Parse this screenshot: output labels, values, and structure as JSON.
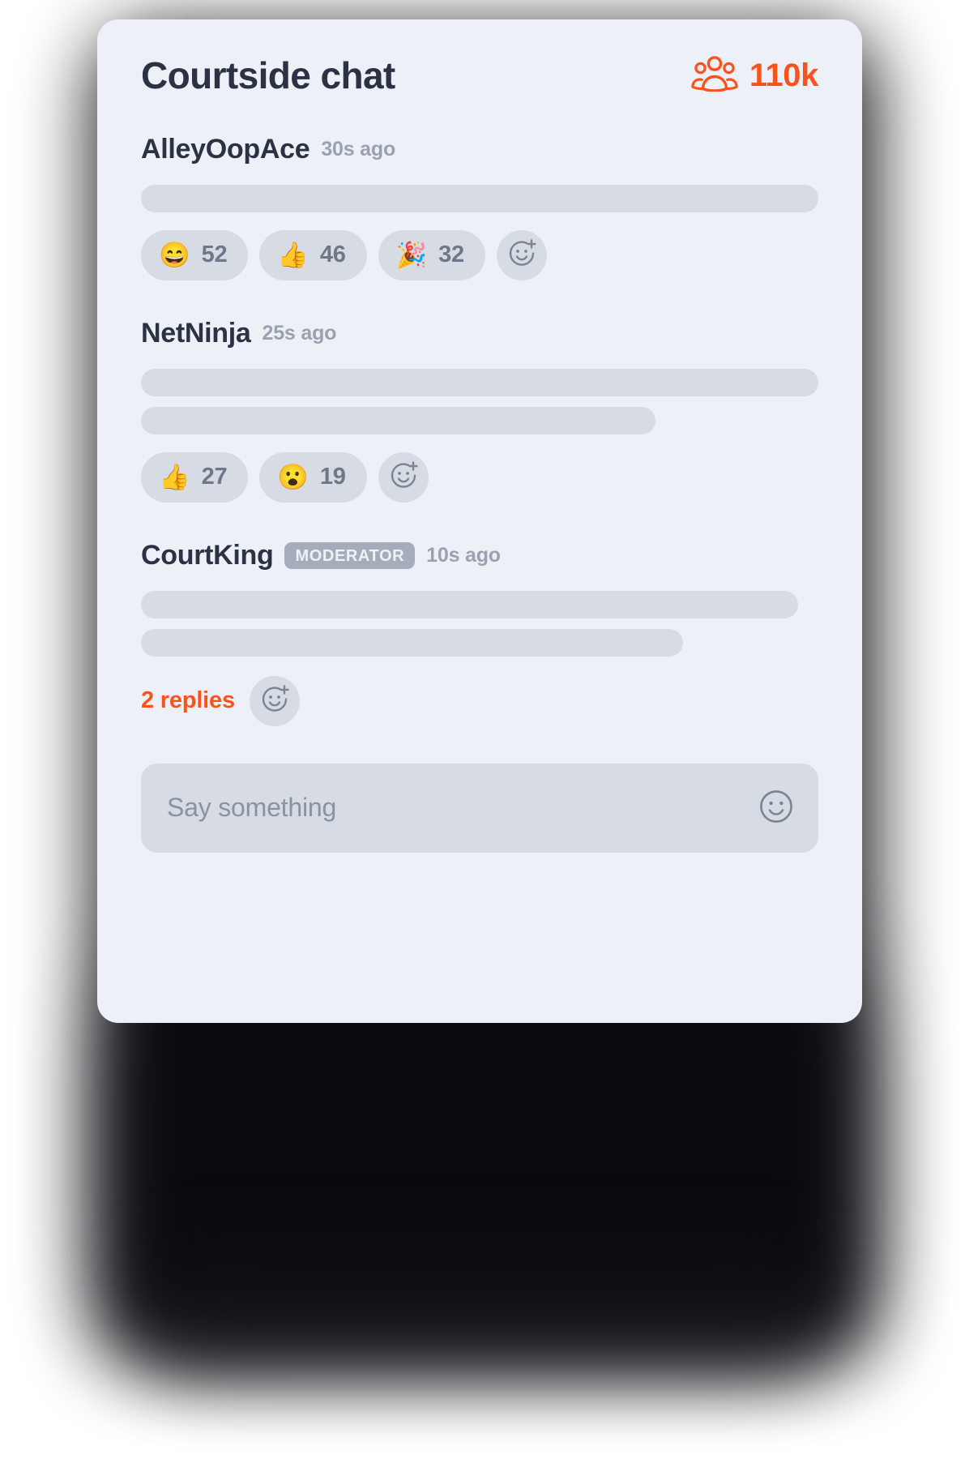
{
  "header": {
    "title": "Courtside chat",
    "viewers_icon": "group-people-icon",
    "viewers_count": "110k",
    "accent_color": "#f8531c"
  },
  "messages": [
    {
      "author": "AlleyOopAce",
      "time": "30s ago",
      "badge": null,
      "line_widths": [
        "100%"
      ],
      "reactions": [
        {
          "emoji": "😄",
          "name": "grinning-face-emoji",
          "count": "52"
        },
        {
          "emoji": "👍",
          "name": "thumbs-up-emoji",
          "count": "46"
        },
        {
          "emoji": "🎉",
          "name": "party-popper-emoji",
          "count": "32"
        }
      ],
      "add_reaction_label": "add-reaction",
      "replies": null
    },
    {
      "author": "NetNinja",
      "time": "25s ago",
      "badge": null,
      "line_widths": [
        "100%",
        "76%"
      ],
      "reactions": [
        {
          "emoji": "👍",
          "name": "thumbs-up-emoji",
          "count": "27"
        },
        {
          "emoji": "😮",
          "name": "face-with-open-mouth-emoji",
          "count": "19"
        }
      ],
      "add_reaction_label": "add-reaction",
      "replies": null
    },
    {
      "author": "CourtKing",
      "time": "10s ago",
      "badge": "MODERATOR",
      "line_widths": [
        "97%",
        "80%"
      ],
      "reactions": [],
      "add_reaction_label": "add-reaction",
      "replies": "2 replies"
    }
  ],
  "composer": {
    "placeholder": "Say something",
    "value": "",
    "emoji_button": "smiley-face-icon"
  },
  "colors": {
    "card_background": "#edf1f7",
    "skeleton": "#d7dbe3",
    "text_primary": "#2b3243",
    "text_muted": "#9aa2b1",
    "badge_background": "#a5adbc",
    "accent": "#f8531c"
  }
}
